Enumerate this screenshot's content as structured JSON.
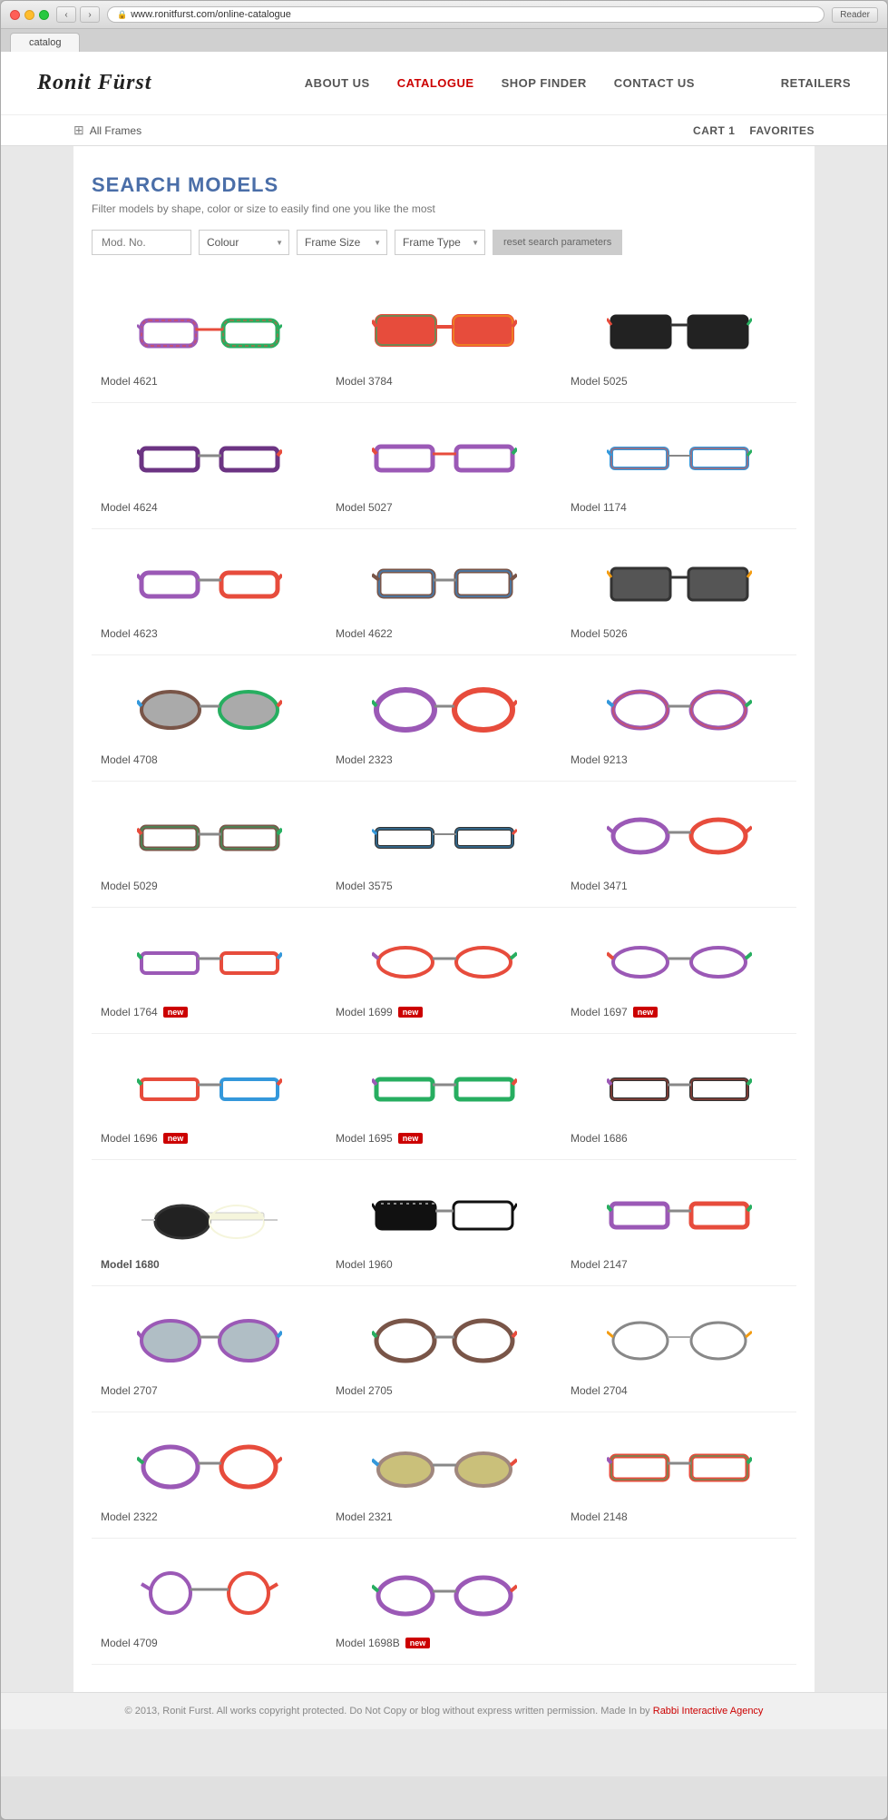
{
  "browser": {
    "tab_title": "catalog",
    "url": "www.ronitfurst.com/online-catalogue",
    "reader_label": "Reader"
  },
  "header": {
    "logo": "Ronit Fürst",
    "nav": [
      {
        "label": "ABOUT US",
        "active": false
      },
      {
        "label": "CATALOGUE",
        "active": true
      },
      {
        "label": "SHOP FINDER",
        "active": false
      },
      {
        "label": "CONTACT US",
        "active": false
      }
    ],
    "retailers_label": "RETAILERS"
  },
  "subheader": {
    "all_frames_label": "All Frames",
    "cart_label": "CART 1",
    "favorites_label": "FAVORITES"
  },
  "search": {
    "title": "SEARCH MODELS",
    "description": "Filter models by shape, color or size to easily find one you like the most",
    "mod_placeholder": "Mod. No.",
    "colour_label": "Colour",
    "frame_size_label": "Frame Size",
    "frame_type_label": "Frame Type",
    "reset_label": "reset search parameters"
  },
  "products": [
    {
      "id": "p1",
      "label": "Model 4621",
      "new": false,
      "bold": false
    },
    {
      "id": "p2",
      "label": "Model 3784",
      "new": false,
      "bold": false
    },
    {
      "id": "p3",
      "label": "Model 5025",
      "new": false,
      "bold": false
    },
    {
      "id": "p4",
      "label": "Model 4624",
      "new": false,
      "bold": false
    },
    {
      "id": "p5",
      "label": "Model 5027",
      "new": false,
      "bold": false
    },
    {
      "id": "p6",
      "label": "Model 1174",
      "new": false,
      "bold": false
    },
    {
      "id": "p7",
      "label": "Model 4623",
      "new": false,
      "bold": false
    },
    {
      "id": "p8",
      "label": "Model 4622",
      "new": false,
      "bold": false
    },
    {
      "id": "p9",
      "label": "Model 5026",
      "new": false,
      "bold": false
    },
    {
      "id": "p10",
      "label": "Model 4708",
      "new": false,
      "bold": false
    },
    {
      "id": "p11",
      "label": "Model 2323",
      "new": false,
      "bold": false
    },
    {
      "id": "p12",
      "label": "Model 9213",
      "new": false,
      "bold": false
    },
    {
      "id": "p13",
      "label": "Model 5029",
      "new": false,
      "bold": false
    },
    {
      "id": "p14",
      "label": "Model 3575",
      "new": false,
      "bold": false
    },
    {
      "id": "p15",
      "label": "Model 3471",
      "new": false,
      "bold": false
    },
    {
      "id": "p16",
      "label": "Model 1764",
      "new": true,
      "bold": false
    },
    {
      "id": "p17",
      "label": "Model 1699",
      "new": true,
      "bold": false
    },
    {
      "id": "p18",
      "label": "Model 1697",
      "new": true,
      "bold": false
    },
    {
      "id": "p19",
      "label": "Model 1696",
      "new": true,
      "bold": false
    },
    {
      "id": "p20",
      "label": "Model 1695",
      "new": true,
      "bold": false
    },
    {
      "id": "p21",
      "label": "Model 1686",
      "new": false,
      "bold": false
    },
    {
      "id": "p22",
      "label": "Model 1680",
      "new": false,
      "bold": true
    },
    {
      "id": "p23",
      "label": "Model 1960",
      "new": false,
      "bold": false
    },
    {
      "id": "p24",
      "label": "Model 2147",
      "new": false,
      "bold": false
    },
    {
      "id": "p25",
      "label": "Model 2707",
      "new": false,
      "bold": false
    },
    {
      "id": "p26",
      "label": "Model 2705",
      "new": false,
      "bold": false
    },
    {
      "id": "p27",
      "label": "Model 2704",
      "new": false,
      "bold": false
    },
    {
      "id": "p28",
      "label": "Model 2322",
      "new": false,
      "bold": false
    },
    {
      "id": "p29",
      "label": "Model 2321",
      "new": false,
      "bold": false
    },
    {
      "id": "p30",
      "label": "Model 2148",
      "new": false,
      "bold": false
    },
    {
      "id": "p31",
      "label": "Model 4709",
      "new": false,
      "bold": false
    },
    {
      "id": "p32",
      "label": "Model 1698B",
      "new": true,
      "bold": false
    }
  ],
  "footer": {
    "text": "© 2013, Ronit Furst. All works copyright protected. Do Not Copy or blog without express written permission. Made In by",
    "agency_link": "Rabbi Interactive Agency"
  }
}
